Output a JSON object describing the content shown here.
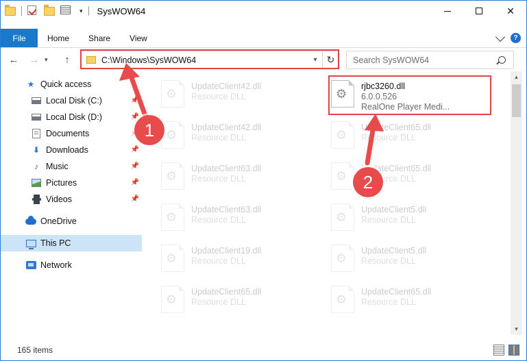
{
  "window": {
    "title": "SysWOW64"
  },
  "ribbon": {
    "file_tab": "File",
    "tabs": [
      "Home",
      "Share",
      "View"
    ]
  },
  "address": {
    "path": "C:\\Windows\\SysWOW64"
  },
  "search": {
    "placeholder": "Search SysWOW64"
  },
  "navpane": {
    "quick_access": "Quick access",
    "items": [
      {
        "label": "Local Disk (C:)",
        "icon": "disk-icon",
        "pinned": true
      },
      {
        "label": "Local Disk (D:)",
        "icon": "disk-icon",
        "pinned": true
      },
      {
        "label": "Documents",
        "icon": "documents-icon",
        "pinned": true
      },
      {
        "label": "Downloads",
        "icon": "downloads-icon",
        "pinned": true
      },
      {
        "label": "Music",
        "icon": "music-icon",
        "pinned": true
      },
      {
        "label": "Pictures",
        "icon": "pictures-icon",
        "pinned": true
      },
      {
        "label": "Videos",
        "icon": "videos-icon",
        "pinned": true
      }
    ],
    "onedrive": "OneDrive",
    "this_pc": "This PC",
    "network": "Network"
  },
  "files": {
    "highlighted": {
      "name": "rjbc3260.dll",
      "version": "6.0.0.526",
      "description": "RealOne Player Medi..."
    },
    "left_column": [
      {
        "name": "UpdateClient42.dll",
        "type": "Resource DLL"
      },
      {
        "name": "UpdateClient42.dll",
        "type": "Resource DLL"
      },
      {
        "name": "UpdateClient63.dll",
        "type": "Resource DLL"
      },
      {
        "name": "UpdateClient63.dll",
        "type": "Resource DLL"
      },
      {
        "name": "UpdateClient19.dll",
        "type": "Resource DLL"
      },
      {
        "name": "UpdateClient65.dll",
        "type": "Resource DLL"
      }
    ],
    "right_column": [
      {
        "name": "UpdateClient65.dll",
        "type": "Resource DLL"
      },
      {
        "name": "UpdateClient65.dll",
        "type": "Resource DLL"
      },
      {
        "name": "UpdateClient5.dll",
        "type": "Resource DLL"
      },
      {
        "name": "UpdateClient5.dll",
        "type": "Resource DLL"
      },
      {
        "name": "UpdateClient65.dll",
        "type": "Resource DLL"
      }
    ]
  },
  "status": {
    "item_count": "165 items"
  },
  "annotations": {
    "step1": "1",
    "step2": "2",
    "color": "#e04545"
  }
}
